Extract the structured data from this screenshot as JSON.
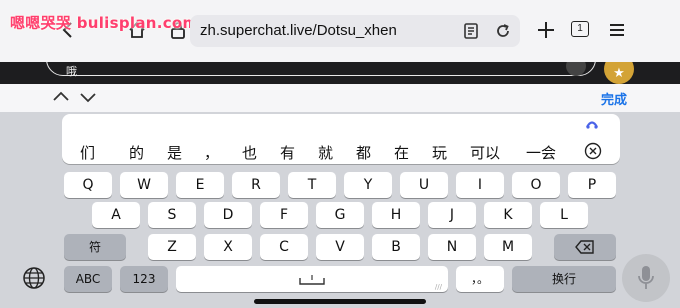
{
  "browser": {
    "watermark": "嗯嗯哭哭 bulisplan.com",
    "url": "zh.superchat.live/Dotsu_xhen",
    "tab_count": "1"
  },
  "page": {
    "input_preview": "哦"
  },
  "accessory": {
    "done_label": "完成"
  },
  "candidates": [
    "们",
    "的",
    "是",
    "，",
    "也",
    "有",
    "就",
    "都",
    "在",
    "玩",
    "可以",
    "一会"
  ],
  "keys": {
    "row1": [
      "Q",
      "W",
      "E",
      "R",
      "T",
      "Y",
      "U",
      "I",
      "O",
      "P"
    ],
    "row2": [
      "A",
      "S",
      "D",
      "F",
      "G",
      "H",
      "J",
      "K",
      "L"
    ],
    "row3": [
      "Z",
      "X",
      "C",
      "V",
      "B",
      "N",
      "M"
    ],
    "symbol_toggle": "符",
    "abc": "ABC",
    "num": "123",
    "punct": "，。",
    "return_label": "换行"
  },
  "colors": {
    "accent": "#1a73e8",
    "watermark": "#ff3f6e",
    "keyboard_bg": "#d2d4d9",
    "key_bg": "#ffffff",
    "key_gray": "#aeb2ba"
  },
  "icons": [
    "back-icon",
    "home-icon",
    "lock-icon",
    "reader-icon",
    "reload-icon",
    "plus-icon",
    "tabs-icon",
    "menu-icon",
    "chevron-up-icon",
    "chevron-down-icon",
    "clear-icon",
    "backspace-icon",
    "globe-icon",
    "microphone-icon"
  ]
}
